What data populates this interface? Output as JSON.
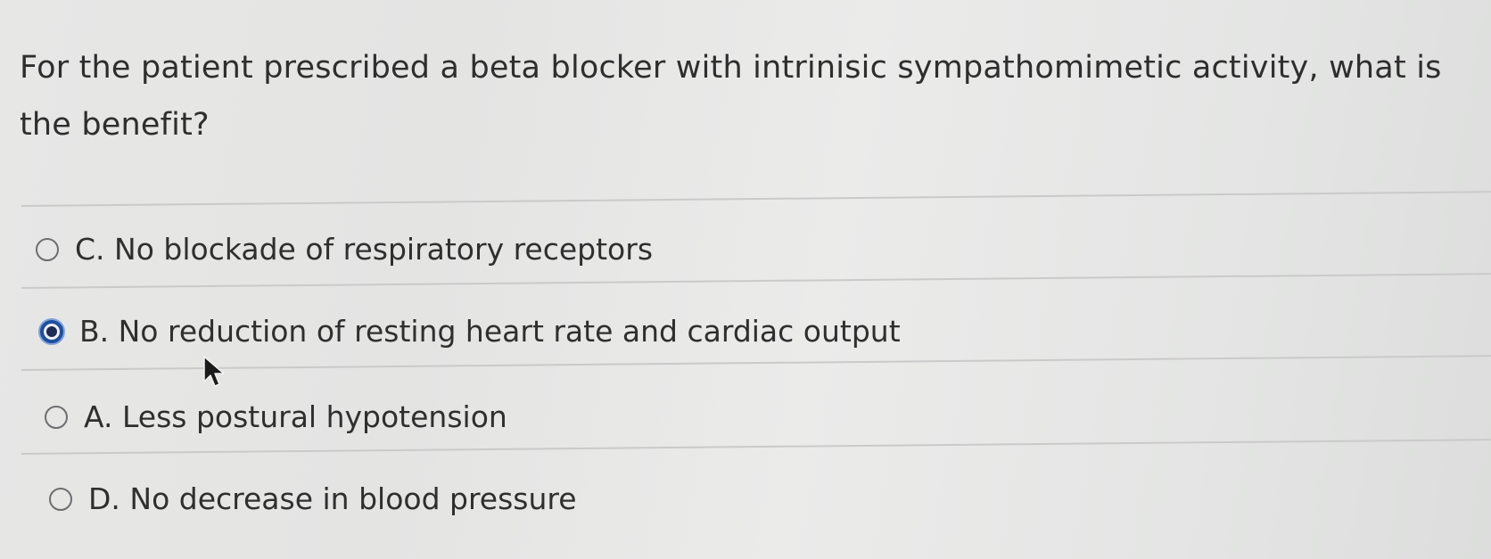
{
  "question": {
    "text": "For the patient prescribed a beta blocker with intrinisic sympathomimetic activity, what is the benefit?"
  },
  "options": [
    {
      "label": "C. No blockade of respiratory receptors",
      "selected": false
    },
    {
      "label": "B. No reduction of resting heart rate and cardiac output",
      "selected": true
    },
    {
      "label": "A. Less postural hypotension",
      "selected": false
    },
    {
      "label": "D. No decrease in blood pressure",
      "selected": false
    }
  ],
  "colors": {
    "selected_radio": "#1e4fa1",
    "text": "#2f2f2f",
    "divider": "#c9cac9"
  },
  "icons": {
    "pointer": "mouse-pointer-icon"
  }
}
